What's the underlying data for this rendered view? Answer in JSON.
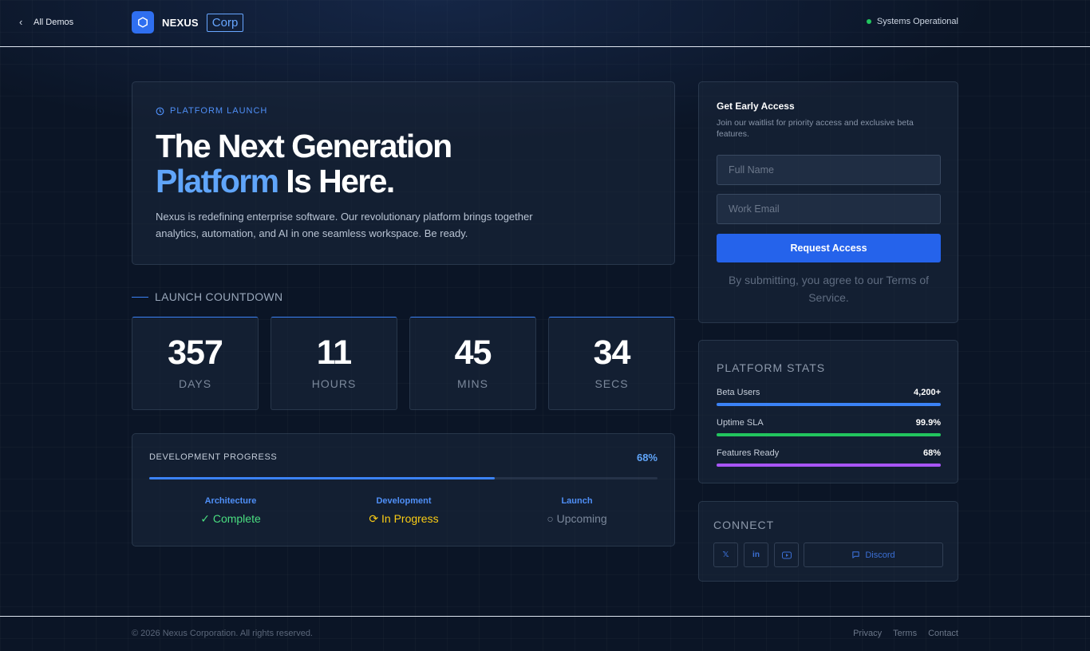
{
  "header": {
    "back_label": "All Demos",
    "brand_name": "NEXUS",
    "brand_tag": "Corp",
    "status_text": "Systems Operational",
    "status_color": "#22c55e"
  },
  "hero": {
    "eyebrow": "PLATFORM LAUNCH",
    "title_line1": "The Next Generation",
    "title_highlight": "Platform",
    "title_rest": " Is Here.",
    "description": "Nexus is redefining enterprise software. Our revolutionary platform brings together analytics, automation, and AI in one seamless workspace. Be ready."
  },
  "countdown": {
    "label": "LAUNCH COUNTDOWN",
    "units": [
      {
        "value": "357",
        "label": "DAYS"
      },
      {
        "value": "11",
        "label": "HOURS"
      },
      {
        "value": "45",
        "label": "MINS"
      },
      {
        "value": "34",
        "label": "SECS"
      }
    ]
  },
  "progress": {
    "title": "DEVELOPMENT PROGRESS",
    "percent_label": "68%",
    "percent": 68,
    "phases": [
      {
        "name": "Architecture",
        "status": "✓ Complete"
      },
      {
        "name": "Development",
        "status": "⟳ In Progress"
      },
      {
        "name": "Launch",
        "status": "○ Upcoming"
      }
    ]
  },
  "access": {
    "title": "Get Early Access",
    "subtitle": "Join our waitlist for priority access and exclusive beta features.",
    "name_placeholder": "Full Name",
    "email_placeholder": "Work Email",
    "button_label": "Request Access",
    "note": "By submitting, you agree to our Terms of Service."
  },
  "stats": {
    "title": "PLATFORM STATS",
    "items": [
      {
        "label": "Beta Users",
        "value": "4,200+",
        "fill": 100,
        "color": "#3b82f6"
      },
      {
        "label": "Uptime SLA",
        "value": "99.9%",
        "fill": 100,
        "color": "#22c55e"
      },
      {
        "label": "Features Ready",
        "value": "68%",
        "fill": 100,
        "color": "#a855f7"
      }
    ]
  },
  "connect": {
    "title": "CONNECT",
    "icons": [
      "x-icon",
      "linkedin-icon",
      "youtube-icon",
      "discord-icon"
    ],
    "x_glyph": "𝕏",
    "linkedin_glyph": "in",
    "discord_label": "Discord"
  },
  "footer": {
    "copyright": "© 2026 Nexus Corporation. All rights reserved.",
    "links": [
      "Privacy",
      "Terms",
      "Contact"
    ]
  },
  "colors": {
    "accent": "#3b82f6",
    "button": "#2563eb",
    "background": "#0b1526"
  }
}
